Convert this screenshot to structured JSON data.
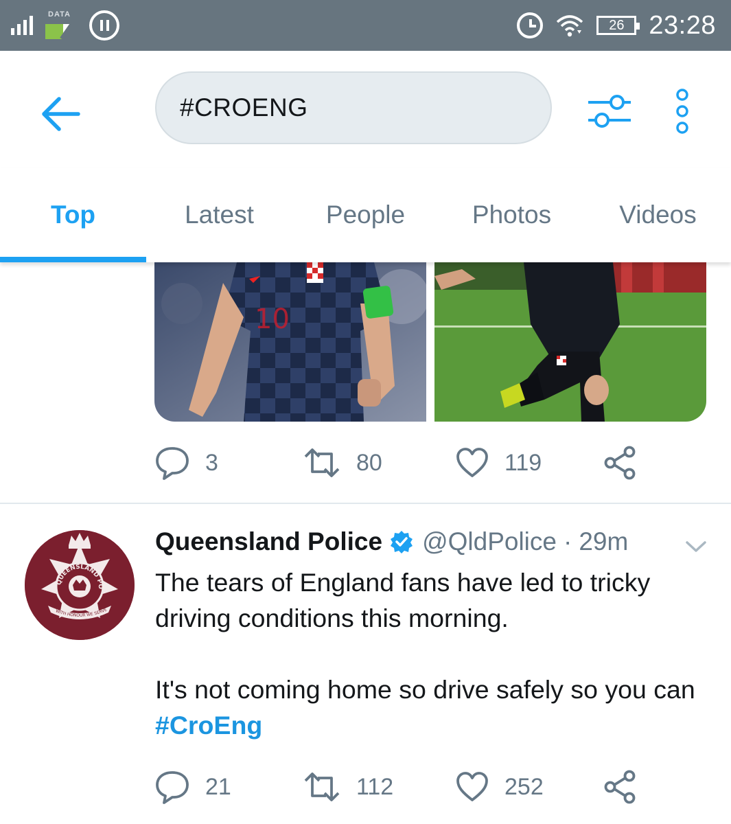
{
  "status_bar": {
    "data_label": "DATA",
    "battery": "26",
    "time": "23:28"
  },
  "search": {
    "query": "#CROENG"
  },
  "tabs": [
    {
      "label": "Top",
      "active": true
    },
    {
      "label": "Latest",
      "active": false
    },
    {
      "label": "People",
      "active": false
    },
    {
      "label": "Photos",
      "active": false
    },
    {
      "label": "Videos",
      "active": false
    }
  ],
  "tweet1": {
    "replies": "3",
    "retweets": "80",
    "likes": "119"
  },
  "tweet2": {
    "name": "Queensland Police",
    "handle": "@QldPolice",
    "separator": "·",
    "time": "29m",
    "text_line1": "The tears of England fans have led to tricky driving conditions this morning.",
    "text_line2_prefix": "It's not coming home so drive safely so you can ",
    "hashtag": "#CroEng",
    "replies": "21",
    "retweets": "112",
    "likes": "252",
    "avatar_text": "QUEENSLAND POLICE",
    "avatar_motto": "WITH HONOUR WE SERVE"
  },
  "colors": {
    "accent": "#1da1f2",
    "status_bar": "#67757f",
    "muted": "#657786",
    "avatar_bg": "#7b1f2e"
  }
}
